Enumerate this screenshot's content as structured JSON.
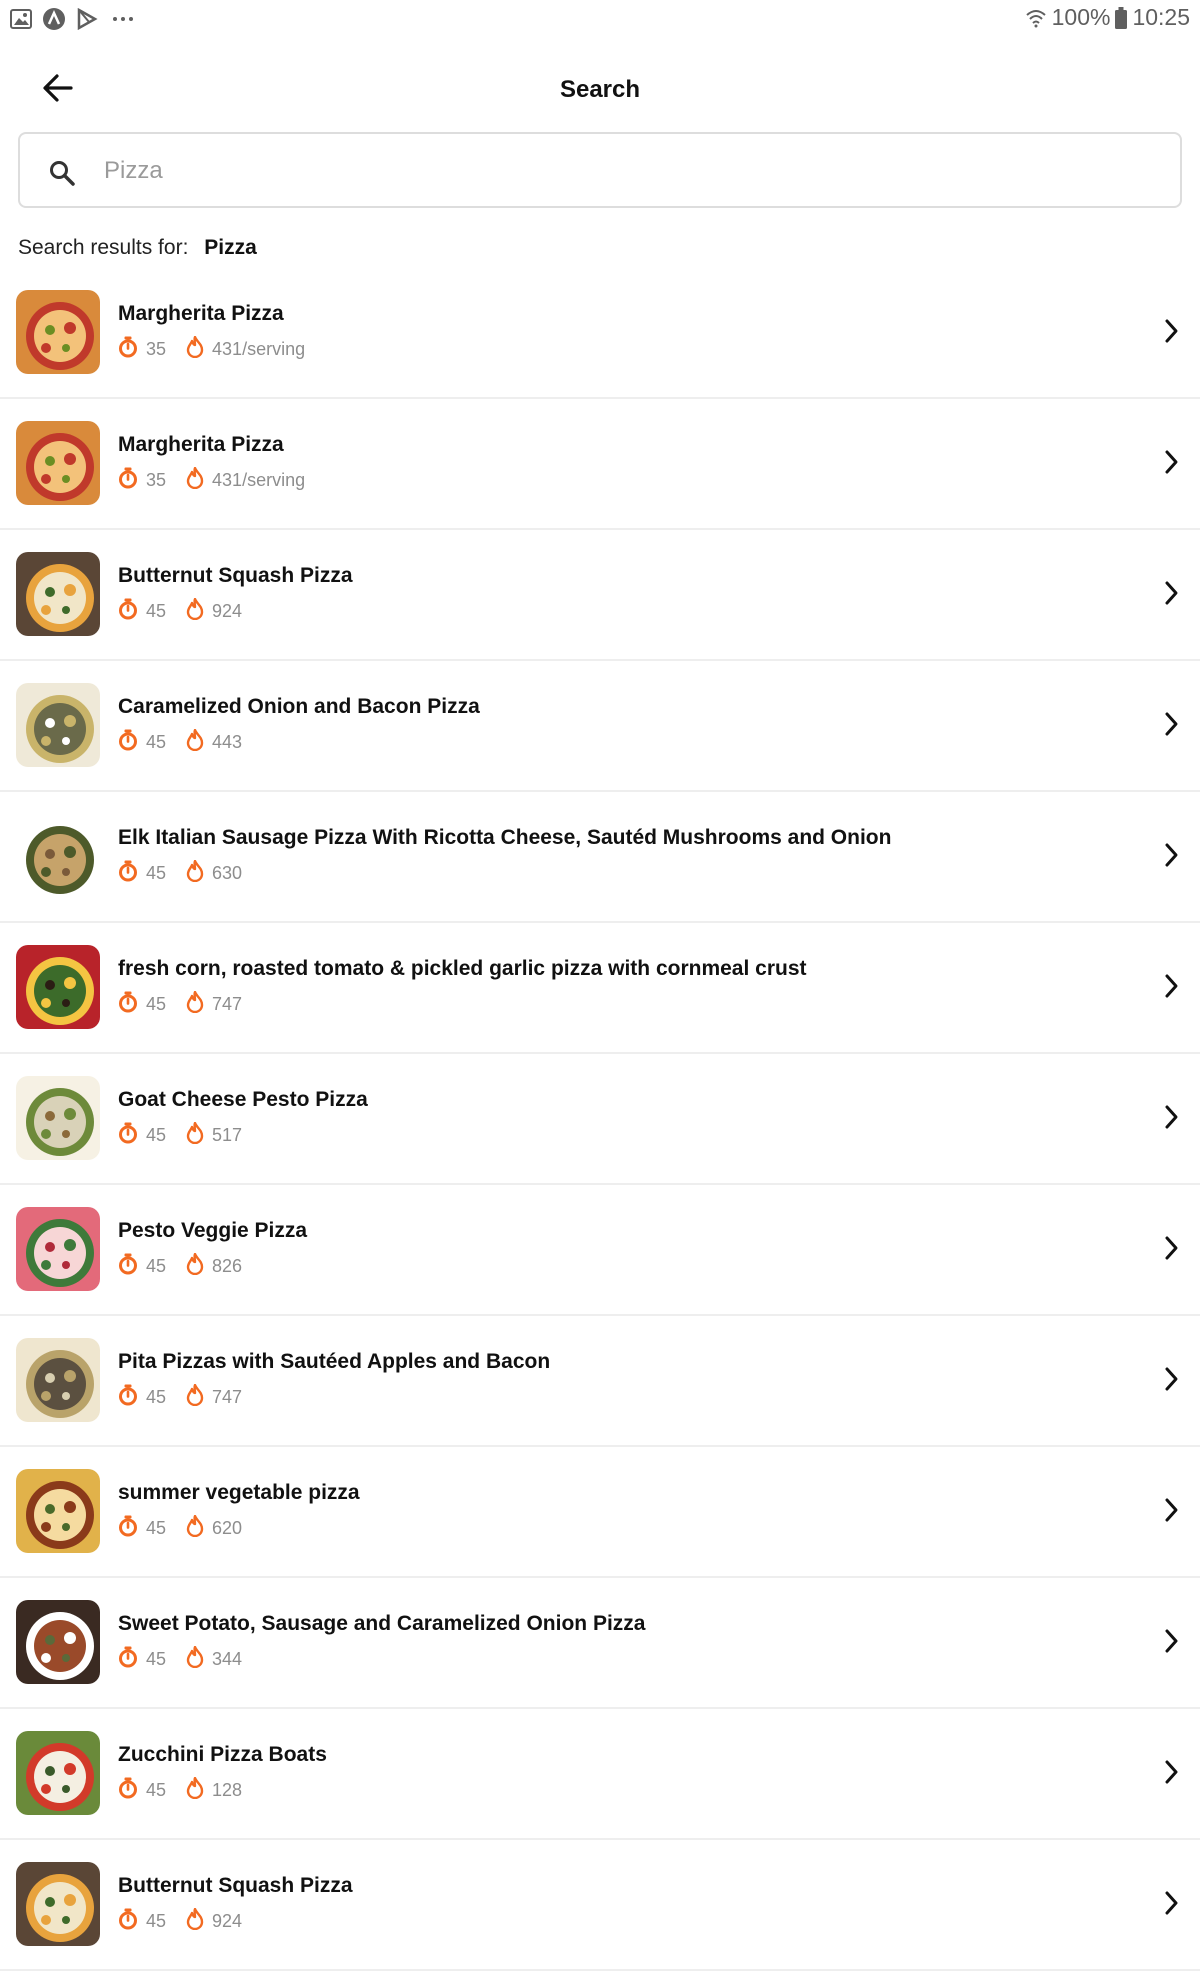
{
  "status_bar": {
    "battery": "100%",
    "time": "10:25",
    "icons": [
      "gallery-icon",
      "app-a-icon",
      "play-store-icon",
      "more-dots-icon",
      "wifi-icon",
      "battery-icon"
    ]
  },
  "app_bar": {
    "title": "Search",
    "back_icon": "arrow-left-icon"
  },
  "search": {
    "placeholder": "Pizza",
    "value": ""
  },
  "results_label": "Search results for:",
  "results_query": "Pizza",
  "colors": {
    "accent": "#f26a21",
    "text": "#111111",
    "meta_text": "#8d8d8d",
    "divider": "#eeeeee"
  },
  "results": [
    {
      "title": "Margherita Pizza",
      "time": "35",
      "calories": "431/serving",
      "thumb": [
        "#d98a3b",
        "#c0392b",
        "#f3c27a",
        "#6b8e23"
      ]
    },
    {
      "title": "Margherita Pizza",
      "time": "35",
      "calories": "431/serving",
      "thumb": [
        "#d98a3b",
        "#c0392b",
        "#f3c27a",
        "#6b8e23"
      ]
    },
    {
      "title": "Butternut Squash Pizza",
      "time": "45",
      "calories": "924",
      "thumb": [
        "#5a4636",
        "#e8a33d",
        "#f1e6c8",
        "#3f6b2a"
      ]
    },
    {
      "title": "Caramelized Onion and Bacon Pizza",
      "time": "45",
      "calories": "443",
      "thumb": [
        "#efe9d8",
        "#c9b46a",
        "#6a6a4a",
        "#ffffff"
      ]
    },
    {
      "title": "Elk Italian Sausage Pizza With Ricotta Cheese, Sautéd Mushrooms and Onion",
      "time": "45",
      "calories": "630",
      "thumb": [
        "#ffffff",
        "#4d5a2a",
        "#c6a36a",
        "#7a5a3a"
      ]
    },
    {
      "title": "fresh corn, roasted tomato & pickled garlic pizza with cornmeal crust",
      "time": "45",
      "calories": "747",
      "thumb": [
        "#b8232a",
        "#f4c542",
        "#3c6b2a",
        "#2b1d14"
      ]
    },
    {
      "title": "Goat Cheese Pesto Pizza",
      "time": "45",
      "calories": "517",
      "thumb": [
        "#f6f1e4",
        "#6d8a3a",
        "#d9d2b8",
        "#8b6a3a"
      ]
    },
    {
      "title": "Pesto Veggie Pizza",
      "time": "45",
      "calories": "826",
      "thumb": [
        "#e36a7a",
        "#3e7a3a",
        "#f7d6d6",
        "#b02a3a"
      ]
    },
    {
      "title": "Pita Pizzas with Sautéed Apples and Bacon",
      "time": "45",
      "calories": "747",
      "thumb": [
        "#efe6cf",
        "#b9a36a",
        "#5b5040",
        "#d8cfb0"
      ]
    },
    {
      "title": "summer vegetable pizza",
      "time": "45",
      "calories": "620",
      "thumb": [
        "#e1b24a",
        "#8a3a1a",
        "#f5dba0",
        "#4a6a2a"
      ]
    },
    {
      "title": "Sweet Potato, Sausage and Caramelized Onion Pizza",
      "time": "45",
      "calories": "344",
      "thumb": [
        "#3a2a22",
        "#ffffff",
        "#9a4a2a",
        "#5a6a3a"
      ]
    },
    {
      "title": "Zucchini Pizza Boats",
      "time": "45",
      "calories": "128",
      "thumb": [
        "#6a8a3a",
        "#d23a2a",
        "#f4efe2",
        "#3a5a2a"
      ]
    },
    {
      "title": "Butternut Squash Pizza",
      "time": "45",
      "calories": "924",
      "thumb": [
        "#5a4636",
        "#e8a33d",
        "#f1e6c8",
        "#3f6b2a"
      ]
    }
  ]
}
